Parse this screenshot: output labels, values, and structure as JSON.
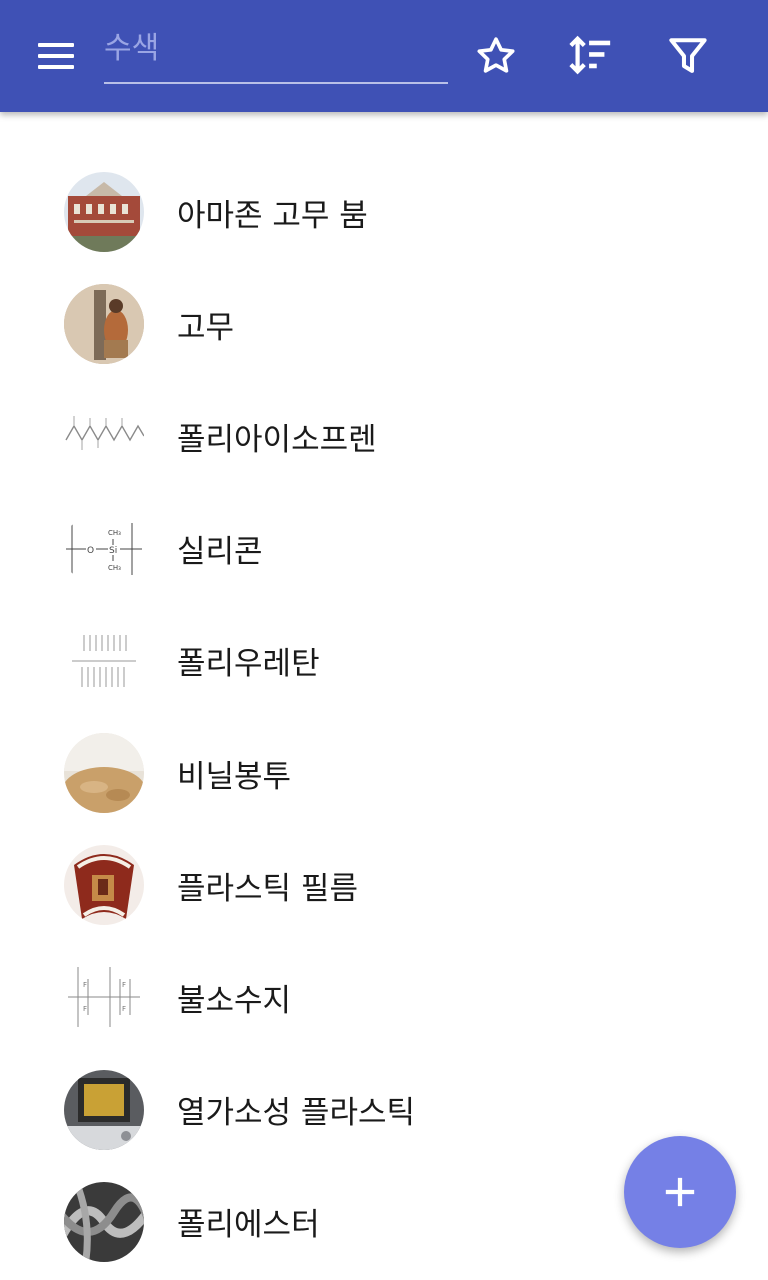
{
  "toolbar": {
    "menu_icon": "menu-icon",
    "search_placeholder": "수색",
    "search_value": "",
    "favorite_icon": "star-outline-icon",
    "sort_icon": "sort-icon",
    "filter_icon": "filter-icon",
    "color": "#3f51b5"
  },
  "items": [
    {
      "label": "아마존 고무 붐",
      "thumbnail": "building-photo"
    },
    {
      "label": "고무",
      "thumbnail": "rubber-tapping-photo"
    },
    {
      "label": "폴리아이소프렌",
      "thumbnail": "chain-diagram"
    },
    {
      "label": "실리콘",
      "thumbnail": "siloxane-formula"
    },
    {
      "label": "폴리우레탄",
      "thumbnail": "structure-diagram"
    },
    {
      "label": "비닐봉투",
      "thumbnail": "bag-photo"
    },
    {
      "label": "플라스틱 필름",
      "thumbnail": "film-reel-photo"
    },
    {
      "label": "불소수지",
      "thumbnail": "ptfe-formula"
    },
    {
      "label": "열가소성 플라스틱",
      "thumbnail": "device-photo"
    },
    {
      "label": "폴리에스터",
      "thumbnail": "fiber-micrograph"
    }
  ],
  "fab": {
    "icon": "plus-icon",
    "color": "#7580e6"
  }
}
